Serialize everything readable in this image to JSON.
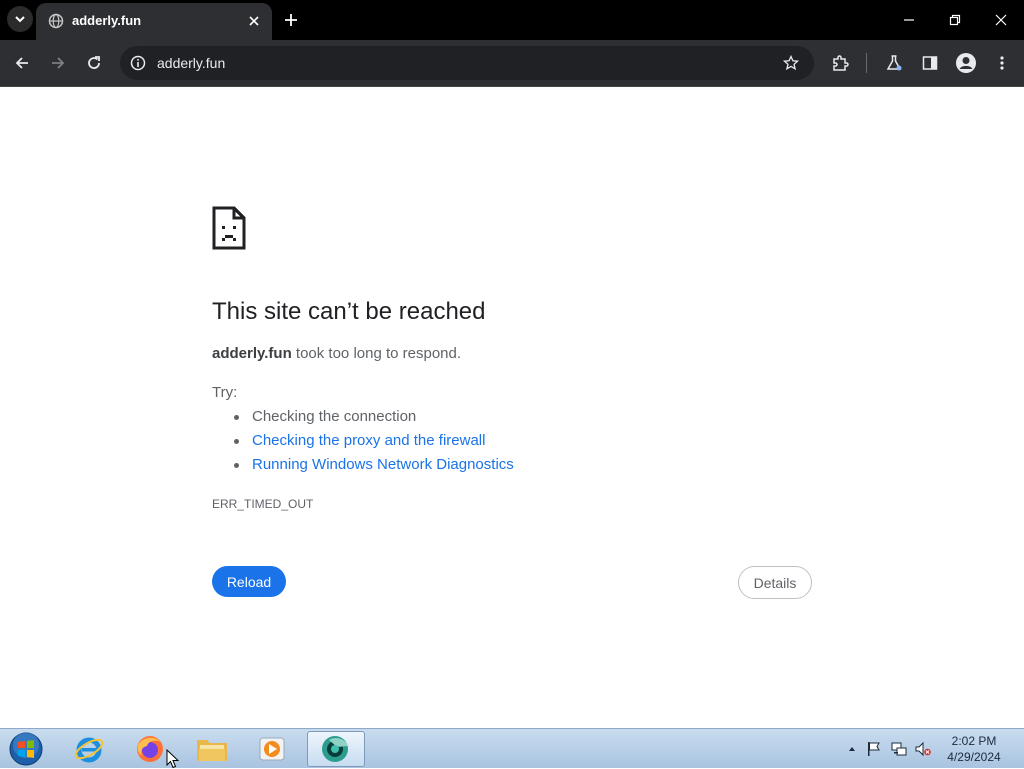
{
  "browser": {
    "tab_title": "adderly.fun",
    "url": "adderly.fun"
  },
  "error_page": {
    "heading": "This site can’t be reached",
    "site": "adderly.fun",
    "message_rest": " took too long to respond.",
    "try_label": "Try:",
    "suggestions": [
      "Checking the connection",
      "Checking the proxy and the firewall",
      "Running Windows Network Diagnostics"
    ],
    "error_code": "ERR_TIMED_OUT",
    "reload_label": "Reload",
    "details_label": "Details"
  },
  "taskbar": {
    "apps": [
      "internet-explorer",
      "firefox",
      "file-explorer",
      "media-player",
      "chrome-app"
    ],
    "time": "2:02 PM",
    "date": "4/29/2024"
  },
  "colors": {
    "accent": "#1a73e8",
    "chrome_dark": "#2e2f33",
    "text_primary": "#202124",
    "text_secondary": "#5f6368"
  }
}
